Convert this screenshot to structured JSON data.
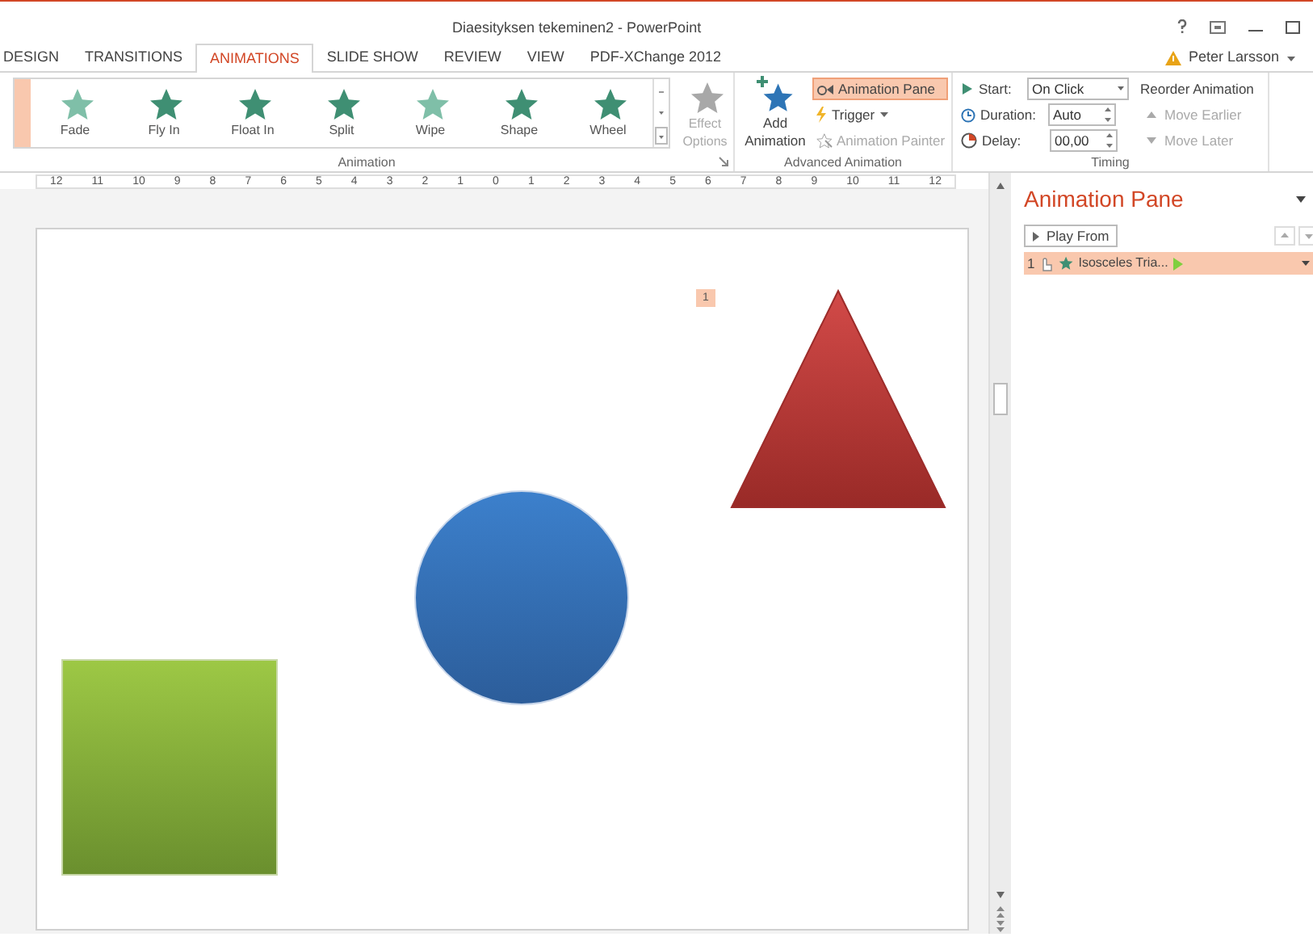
{
  "window": {
    "title": "Diaesityksen tekeminen2 - PowerPoint"
  },
  "tabs": [
    {
      "label": "DESIGN",
      "selected": false
    },
    {
      "label": "TRANSITIONS",
      "selected": false
    },
    {
      "label": "ANIMATIONS",
      "selected": true
    },
    {
      "label": "SLIDE SHOW",
      "selected": false
    },
    {
      "label": "REVIEW",
      "selected": false
    },
    {
      "label": "VIEW",
      "selected": false
    },
    {
      "label": "PDF-XChange 2012",
      "selected": false
    }
  ],
  "user": {
    "name": "Peter Larsson"
  },
  "animation_gallery": {
    "items": [
      "Fade",
      "Fly In",
      "Float In",
      "Split",
      "Wipe",
      "Shape",
      "Wheel"
    ],
    "group_label": "Animation"
  },
  "effect_options": {
    "label": "Effect Options",
    "disabled": true
  },
  "advanced_animation": {
    "add_animation": "Add Animation",
    "animation_pane": {
      "label": "Animation Pane",
      "selected": true
    },
    "trigger": {
      "label": "Trigger",
      "disabled": false
    },
    "animation_painter": {
      "label": "Animation Painter",
      "disabled": true
    },
    "group_label": "Advanced Animation"
  },
  "timing": {
    "start": {
      "label": "Start:",
      "value": "On Click"
    },
    "duration": {
      "label": "Duration:",
      "value": "Auto"
    },
    "delay": {
      "label": "Delay:",
      "value": "00,00"
    },
    "reorder_title": "Reorder Animation",
    "move_earlier": {
      "label": "Move Earlier",
      "disabled": true
    },
    "move_later": {
      "label": "Move Later",
      "disabled": true
    },
    "group_label": "Timing"
  },
  "ruler": [
    "12",
    "11",
    "10",
    "9",
    "8",
    "7",
    "6",
    "5",
    "4",
    "3",
    "2",
    "1",
    "0",
    "1",
    "2",
    "3",
    "4",
    "5",
    "6",
    "7",
    "8",
    "9",
    "10",
    "11",
    "12"
  ],
  "slide": {
    "animation_tag": "1"
  },
  "animation_pane": {
    "title": "Animation Pane",
    "play_from": "Play From",
    "items": [
      {
        "number": "1",
        "name": "Isosceles Tria...",
        "selected": true
      }
    ]
  }
}
